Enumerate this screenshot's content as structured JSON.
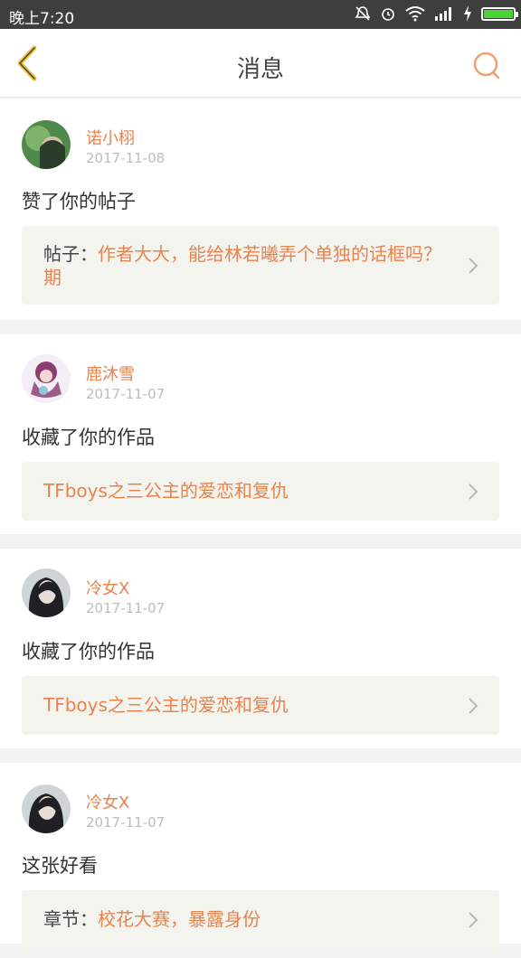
{
  "status": {
    "time": "晚上7:20"
  },
  "header": {
    "title": "消息"
  },
  "items": [
    {
      "name": "诺小栩",
      "date": "2017-11-08",
      "action": "赞了你的帖子",
      "prefix": "帖子：",
      "link": "作者大大，能给林若曦弄个单独的话框吗？期"
    },
    {
      "name": "鹿沐雪",
      "date": "2017-11-07",
      "action": "收藏了你的作品",
      "prefix": "",
      "link": "TFboys之三公主的爱恋和复仇"
    },
    {
      "name": "冷女X",
      "date": "2017-11-07",
      "action": "收藏了你的作品",
      "prefix": "",
      "link": "TFboys之三公主的爱恋和复仇"
    },
    {
      "name": "冷女X",
      "date": "2017-11-07",
      "action": "这张好看",
      "prefix": "章节：",
      "link": "校花大赛，暴露身份"
    }
  ],
  "colors": {
    "accent": "#e8834f",
    "linkbox": "#f4f4ef",
    "statusbar": "#3e3e3e"
  }
}
